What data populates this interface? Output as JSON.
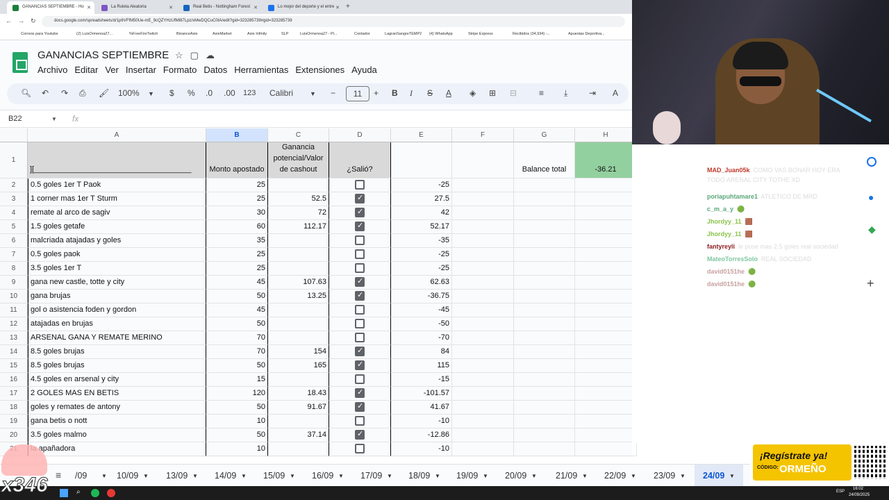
{
  "browser": {
    "tabs": [
      {
        "label": "GANANCIAS SEPTIEMBRE - Ho",
        "color": "#188038"
      },
      {
        "label": "La Ruleta Aleatoria",
        "color": "#7e57c2"
      },
      {
        "label": "Real Betis - Nottingham Forest",
        "color": "#1565c0"
      },
      {
        "label": "Lo mejor del deporte y el entre",
        "color": "#1a73e8"
      }
    ],
    "new_tab": "+",
    "url": "docs.google.com/spreadsheets/d/1p6VFfM50Ue-mE_9cQZYHzUfMl87Lpz/xMwDQCuC0tA/edit?gid=323285739#gid=323285739",
    "bookmarks": [
      "Correos para Youtube",
      "(2) LuisOrmenoa27...",
      "%FreeFireTwitch",
      "BinanceAxie",
      "AxieMarket",
      "Axie Infinity",
      "SLP",
      "LuisOrmenoa27 - Pl...",
      "Contador",
      "LagranSangreTEMP2",
      "(4) WhatsApp",
      "Stripe Express",
      "Recibidos (34,934) -...",
      "Apuestas Deportiva..."
    ]
  },
  "sheets": {
    "title": "GANANCIAS SEPTIEMBRE",
    "menu": [
      "Archivo",
      "Editar",
      "Ver",
      "Insertar",
      "Formato",
      "Datos",
      "Herramientas",
      "Extensiones",
      "Ayuda"
    ],
    "toolbar": {
      "zoom": "100%",
      "currency": "$",
      "percent": "%",
      "dec_minus": ".0",
      "dec_plus": ".00",
      "format": "123",
      "font": "Calibri",
      "font_size": "11",
      "minus": "−",
      "plus": "+"
    },
    "name_box": "B22",
    "fx": "fx",
    "columns": [
      "A",
      "B",
      "C",
      "D",
      "E",
      "F",
      "G",
      "H"
    ],
    "header_row": {
      "row_num": "1",
      "a": "][_____________________________________",
      "b": "Monto apostado",
      "c": "Ganancia potencial/Valor de cashout",
      "d": "¿Salió?",
      "g": "Balance total",
      "h": "-36.21"
    },
    "rows": [
      {
        "n": "2",
        "a": "0.5 goles 1er T Paok",
        "b": "25",
        "c": "",
        "d": false,
        "e": "-25"
      },
      {
        "n": "3",
        "a": "1 corner mas 1er T Sturm",
        "b": "25",
        "c": "52.5",
        "d": true,
        "e": "27.5"
      },
      {
        "n": "4",
        "a": "remate al arco de sagiv",
        "b": "30",
        "c": "72",
        "d": true,
        "e": "42"
      },
      {
        "n": "5",
        "a": "1.5 goles getafe",
        "b": "60",
        "c": "112.17",
        "d": true,
        "e": "52.17"
      },
      {
        "n": "6",
        "a": "malcriada atajadas y goles",
        "b": "35",
        "c": "",
        "d": false,
        "e": "-35"
      },
      {
        "n": "7",
        "a": "0.5 goles paok",
        "b": "25",
        "c": "",
        "d": false,
        "e": "-25"
      },
      {
        "n": "8",
        "a": "3.5 goles 1er T",
        "b": "25",
        "c": "",
        "d": false,
        "e": "-25"
      },
      {
        "n": "9",
        "a": "gana new castle, totte y city",
        "b": "45",
        "c": "107.63",
        "d": true,
        "e": "62.63"
      },
      {
        "n": "10",
        "a": "gana brujas",
        "b": "50",
        "c": "13.25",
        "d": true,
        "e": "-36.75"
      },
      {
        "n": "11",
        "a": "gol o asistencia foden y gordon",
        "b": "45",
        "c": "",
        "d": false,
        "e": "-45"
      },
      {
        "n": "12",
        "a": "atajadas en brujas",
        "b": "50",
        "c": "",
        "d": false,
        "e": "-50"
      },
      {
        "n": "13",
        "a": "ARSENAL GANA Y REMATE MERINO",
        "b": "70",
        "c": "",
        "d": false,
        "e": "-70"
      },
      {
        "n": "14",
        "a": "8.5 goles brujas",
        "b": "70",
        "c": "154",
        "d": true,
        "e": "84"
      },
      {
        "n": "15",
        "a": "8.5 goles brujas",
        "b": "50",
        "c": "165",
        "d": true,
        "e": "115"
      },
      {
        "n": "16",
        "a": "4.5 goles en arsenal y city",
        "b": "15",
        "c": "",
        "d": false,
        "e": "-15"
      },
      {
        "n": "17",
        "a": "2 GOLES MAS EN BETIS",
        "b": "120",
        "c": "18.43",
        "d": true,
        "e": "-101.57"
      },
      {
        "n": "18",
        "a": "goles y remates de antony",
        "b": "50",
        "c": "91.67",
        "d": true,
        "e": "41.67"
      },
      {
        "n": "19",
        "a": "gana betis o nott",
        "b": "10",
        "c": "",
        "d": false,
        "e": "-10"
      },
      {
        "n": "20",
        "a": "3.5 goles malmo",
        "b": "50",
        "c": "37.14",
        "d": true,
        "e": "-12.86"
      },
      {
        "n": "21",
        "a": "la apañadora",
        "b": "10",
        "c": "",
        "d": false,
        "e": "-10"
      }
    ],
    "sheet_tabs": [
      "/09",
      "10/09",
      "13/09",
      "14/09",
      "15/09",
      "16/09",
      "17/09",
      "18/09",
      "19/09",
      "20/09",
      "21/09",
      "22/09",
      "23/09",
      "24/09"
    ],
    "active_tab": "24/09"
  },
  "chat": [
    {
      "user": "MAD_Juan05k",
      "color": "#c0392b",
      "msg": ": COMO VAS BONAR HOY ERA TODO ARENAL CITY TOTHE XD"
    },
    {
      "user": "poriapuhtamare1",
      "color": "#5aa87a",
      "msg": ": ATLETICO DE MRD"
    },
    {
      "user": "c_m_a_y",
      "color": "#5aa87a",
      "msg": ": 🟢"
    },
    {
      "user": "Jhordyy_11",
      "color": "#8bc34a",
      "msg": ": 🟫"
    },
    {
      "user": "Jhordyy_11",
      "color": "#8bc34a",
      "msg": ": 🟫"
    },
    {
      "user": "fantyreyli",
      "color": "#8e2020",
      "msg": ": le puse mas 2.5 goles real sociedad"
    },
    {
      "user": "MateoTorresSolo",
      "color": "#7fc6a4",
      "msg": ": REAL SOCIEDAD"
    },
    {
      "user": "david0151he",
      "color": "#c9a0a0",
      "msg": ": 🟢"
    },
    {
      "user": "david0151he",
      "color": "#c9a0a0",
      "msg": ": 🟢"
    }
  ],
  "promo": {
    "line1": "¡Regístrate ya!",
    "code_label": "CÓDIGO:",
    "code": "ORMEÑO"
  },
  "overlay_number": "x346",
  "taskbar": {
    "time": "16:02",
    "date": "24/09/2025",
    "lang": "ESP"
  }
}
